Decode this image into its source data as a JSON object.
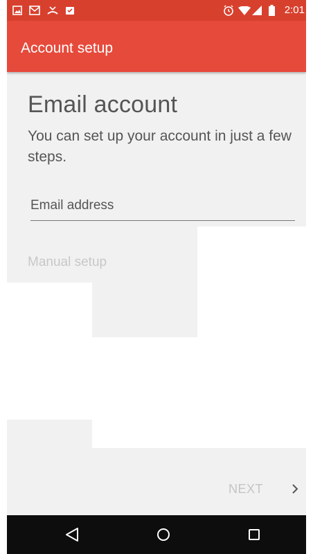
{
  "status_bar": {
    "time": "2:01",
    "left_icons": [
      "image-icon",
      "gmail-icon",
      "missed-call-icon",
      "task-icon"
    ],
    "right_icons": [
      "alarm-icon",
      "wifi-icon",
      "signal-icon",
      "battery-icon"
    ]
  },
  "app_bar": {
    "title": "Account setup"
  },
  "main": {
    "heading": "Email account",
    "subtitle": "You can set up your account in just a few steps.",
    "email_field": {
      "placeholder": "Email address",
      "value": ""
    },
    "manual_setup_label": "Manual setup"
  },
  "footer": {
    "next_label": "NEXT",
    "next_icon": "chevron-right-icon"
  },
  "nav_bar": {
    "buttons": [
      "back-icon",
      "home-icon",
      "recents-icon"
    ]
  },
  "colors": {
    "status_bar": "#d8402e",
    "app_bar": "#e64a3b",
    "background": "#f1f1f1",
    "nav_bar": "#0d0d0d",
    "disabled_text": "#c4c4c4"
  }
}
